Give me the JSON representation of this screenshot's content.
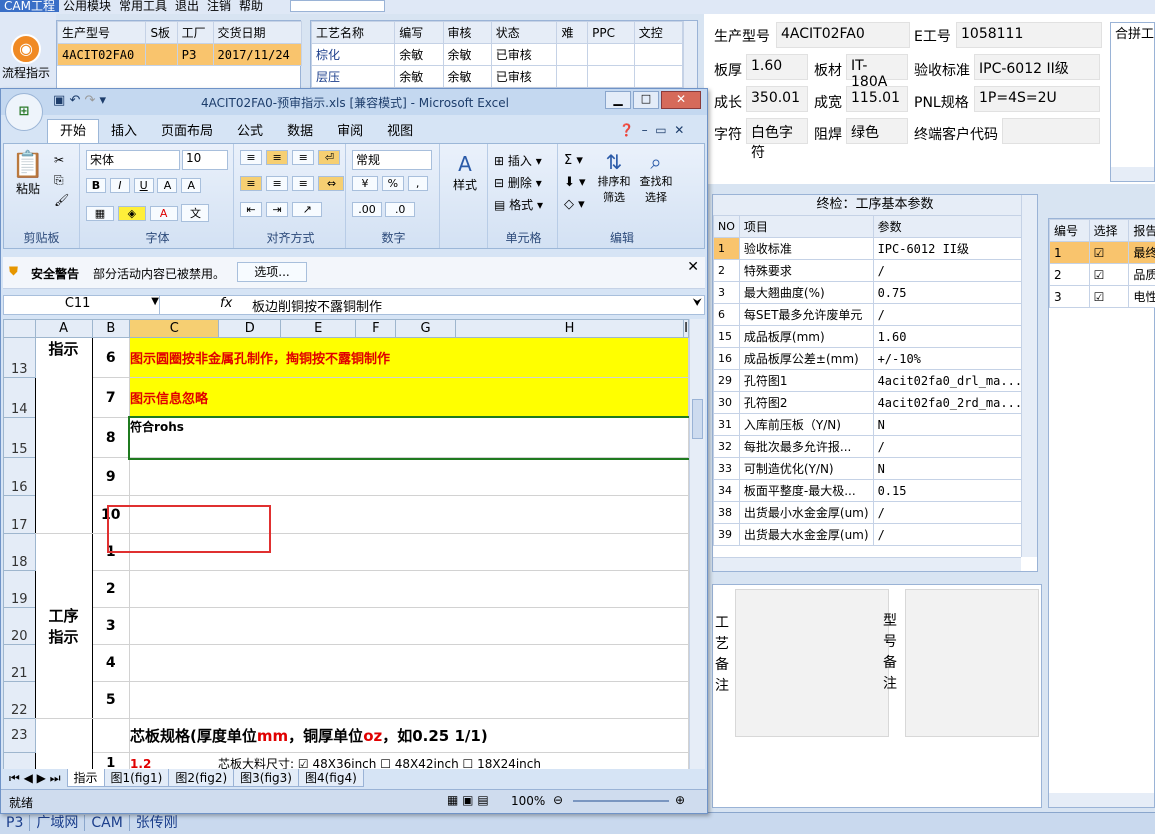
{
  "host": {
    "menu": [
      "CAM工程",
      "公用模块",
      "常用工具",
      "退出",
      "注销",
      "帮助"
    ],
    "flow_button": "流程指示",
    "order_table": {
      "headers": [
        "生产型号",
        "S板",
        "工厂",
        "交货日期"
      ],
      "row": [
        "4ACIT02FA0",
        "",
        "P3",
        "2017/11/24"
      ]
    },
    "process_table": {
      "headers": [
        "工艺名称",
        "编写",
        "审核",
        "状态",
        "难",
        "PPC",
        "文控"
      ],
      "rows": [
        [
          "棕化",
          "余敏",
          "余敏",
          "已审核",
          "",
          "",
          ""
        ],
        [
          "层压",
          "余敏",
          "余敏",
          "已审核",
          "",
          "",
          ""
        ]
      ]
    },
    "fields": {
      "model_label": "生产型号",
      "model_value": "4ACIT02FA0",
      "eno_label": "E工号",
      "eno_value": "1058111",
      "thick_label": "板厚",
      "thick_value": "1.60",
      "material_label": "板材",
      "material_value": "IT-180A",
      "std_label": "验收标准",
      "std_value": "IPC-6012 II级",
      "len_label": "成长",
      "len_value": "350.01",
      "wid_label": "成宽",
      "wid_value": "115.01",
      "pnl_label": "PNL规格",
      "pnl_value": "1P=4S=2U",
      "char_label": "字符",
      "char_value": "白色字符",
      "mask_label": "阻焊",
      "mask_value": "绿色",
      "cust_label": "终端客户代码",
      "cust_value": ""
    },
    "merge_label": "合拼工",
    "params": {
      "title": "终检：工序基本参数",
      "headers": [
        "NO",
        "项目",
        "参数"
      ],
      "rows": [
        [
          "1",
          "验收标准",
          "IPC-6012 II级"
        ],
        [
          "2",
          "特殊要求",
          "/"
        ],
        [
          "3",
          "最大翘曲度(%)",
          "0.75"
        ],
        [
          "6",
          "每SET最多允许废单元",
          "/"
        ],
        [
          "15",
          "成品板厚(mm)",
          "1.60"
        ],
        [
          "16",
          "成品板厚公差±(mm)",
          "+/-10%"
        ],
        [
          "29",
          "孔符图1",
          "4acit02fa0_drl_ma..."
        ],
        [
          "30",
          "孔符图2",
          "4acit02fa0_2rd_ma..."
        ],
        [
          "31",
          "入库前压板（Y/N)",
          "N"
        ],
        [
          "32",
          "每批次最多允许报...",
          "/"
        ],
        [
          "33",
          "可制造优化(Y/N)",
          "N"
        ],
        [
          "34",
          "板面平整度-最大极...",
          "0.15"
        ],
        [
          "38",
          "出货最小水金金厚(um)",
          "/"
        ],
        [
          "39",
          "出货最大水金金厚(um)",
          "/"
        ]
      ]
    },
    "right_table": {
      "headers": [
        "编号",
        "选择",
        "报告"
      ],
      "rows": [
        [
          "1",
          "最终"
        ],
        [
          "2",
          "品质"
        ],
        [
          "3",
          "电性"
        ]
      ]
    },
    "notes": {
      "process_label": "工艺备注",
      "model_label": "型号备注"
    },
    "taskbar": [
      "P3",
      "广域网",
      "CAM",
      "张传刚"
    ]
  },
  "excel": {
    "title": "4ACIT02FA0-预审指示.xls  [兼容模式] - Microsoft Excel",
    "tabs": [
      "开始",
      "插入",
      "页面布局",
      "公式",
      "数据",
      "审阅",
      "视图"
    ],
    "groups": {
      "clipboard": "剪贴板",
      "paste": "粘贴",
      "font": "字体",
      "font_name": "宋体",
      "font_size": "10",
      "align": "对齐方式",
      "number": "数字",
      "number_format": "常规",
      "style": "样式",
      "cells": "单元格",
      "insert": "插入",
      "delete": "删除",
      "format": "格式",
      "edit": "编辑",
      "sort": "排序和\n筛选",
      "find": "查找和\n选择"
    },
    "security": {
      "title": "安全警告",
      "text": "部分活动内容已被禁用。",
      "button": "选项..."
    },
    "namebox": "C11",
    "formula": "板边削铜按不露铜制作",
    "columns": [
      "A",
      "B",
      "C",
      "D",
      "E",
      "F",
      "G",
      "H",
      "I"
    ],
    "rows": [
      {
        "n": "13",
        "b": "6",
        "text": "图示圆圈按非金属孔制作，掏铜按不露铜制作",
        "yellow": true
      },
      {
        "n": "14",
        "b": "7",
        "text": "图示信息忽略",
        "yellow": true
      },
      {
        "n": "15",
        "b": "8",
        "text": "符合rohs",
        "yellow": false
      },
      {
        "n": "16",
        "b": "9",
        "text": "",
        "yellow": false
      },
      {
        "n": "17",
        "b": "10",
        "text": "",
        "yellow": false
      },
      {
        "n": "18",
        "b": "1",
        "text": "",
        "yellow": false
      },
      {
        "n": "19",
        "b": "2",
        "text": "",
        "yellow": false
      },
      {
        "n": "20",
        "b": "3",
        "text": "",
        "yellow": false
      },
      {
        "n": "21",
        "b": "4",
        "text": "",
        "yellow": false
      },
      {
        "n": "22",
        "b": "5",
        "text": "",
        "yellow": false
      }
    ],
    "section1": "指示",
    "section2": "工序\n指示",
    "row23": {
      "n": "23",
      "pre": "芯板规格(厚度单位",
      "mm": "mm",
      "mid": "，铜厚单位",
      "oz": "oz",
      "post": "，如0.25 1/1)"
    },
    "row24": {
      "b": "1",
      "c": "1.2",
      "size_label": "芯板大料尺寸:",
      "opt1": "48X36inch",
      "opt2": "48X42inch",
      "opt3": "18X24inch"
    },
    "sheets": [
      "指示",
      "图1(fig1)",
      "图2(fig2)",
      "图3(fig3)",
      "图4(fig4)"
    ],
    "status": "就绪",
    "zoom": "100%"
  }
}
